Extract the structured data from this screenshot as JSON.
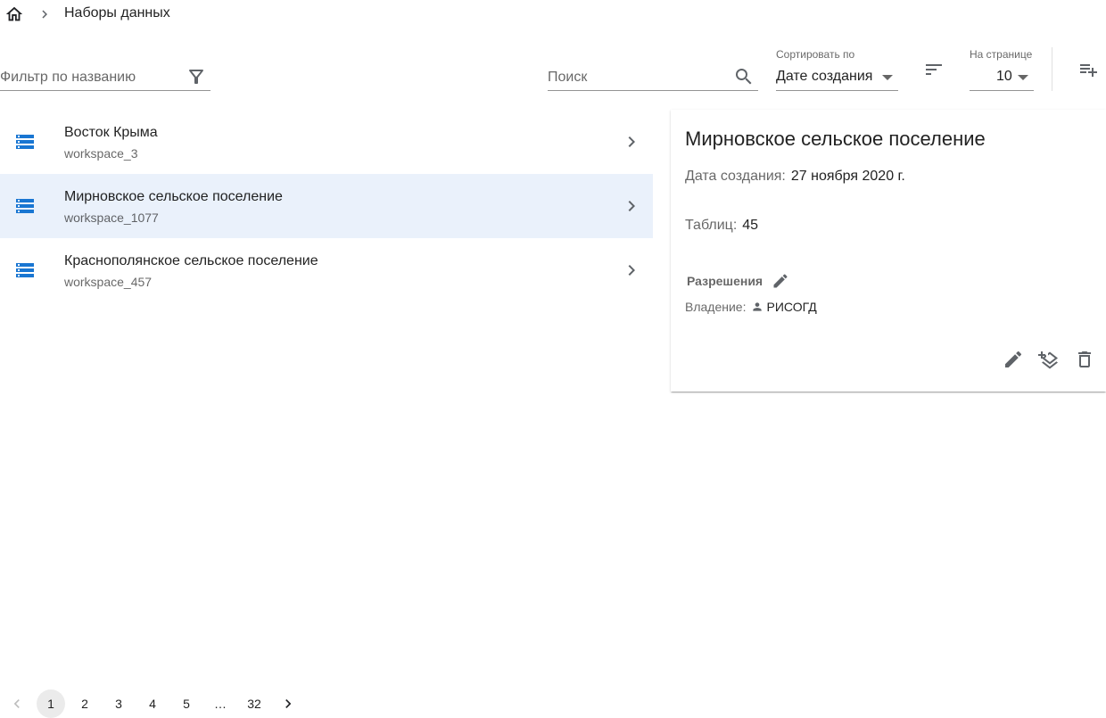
{
  "breadcrumb": {
    "home_icon": "home-icon",
    "separator_icon": "chevron-right-icon",
    "current": "Наборы данных"
  },
  "toolbar": {
    "filter": {
      "placeholder": "Фильтр по названию",
      "value": "",
      "icon": "filter-icon"
    },
    "search": {
      "placeholder": "Поиск",
      "value": "",
      "icon": "search-icon"
    },
    "sort": {
      "label": "Сортировать по",
      "value": "Дате создания"
    },
    "sort_direction_icon": "sort-icon",
    "per_page": {
      "label": "На странице",
      "value": "10"
    },
    "add_icon": "playlist-add-icon"
  },
  "datasets": [
    {
      "title": "Восток Крыма",
      "subtitle": "workspace_3",
      "selected": false
    },
    {
      "title": "Мирновское сельское поселение",
      "subtitle": "workspace_1077",
      "selected": true
    },
    {
      "title": "Краснополянское сельское поселение",
      "subtitle": "workspace_457",
      "selected": false
    }
  ],
  "detail": {
    "title": "Мирновское сельское поселение",
    "created_label": "Дата создания:",
    "created_value": "27 ноября 2020 г.",
    "tables_label": "Таблиц:",
    "tables_value": "45",
    "permissions_title": "Разрешения",
    "owner_label": "Владение:",
    "owner_value": "РИСОГД",
    "actions": [
      "edit-icon",
      "add-layers-icon",
      "delete-icon"
    ]
  },
  "pagination": {
    "pages": [
      "1",
      "2",
      "3",
      "4",
      "5"
    ],
    "ellipsis": "…",
    "last": "32",
    "current": "1"
  },
  "colors": {
    "accent": "#1976d2",
    "selected_row": "#eaf1fb",
    "icon": "#5f6368"
  }
}
